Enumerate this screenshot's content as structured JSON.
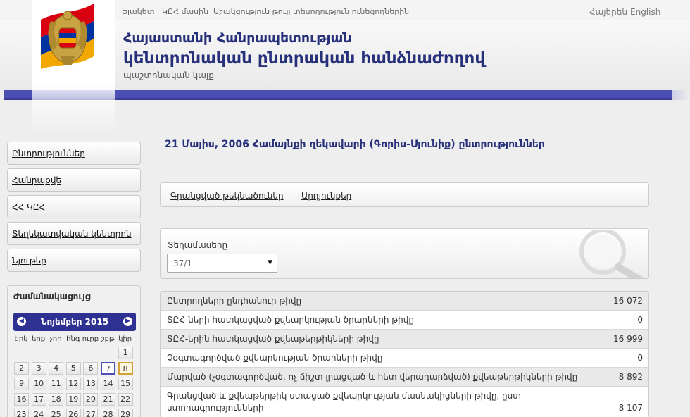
{
  "topnav": {
    "links": [
      "Ելակետ",
      "ԿԸՀ մասին",
      "Աշակցություն թույլ տեսողություն ունեցողներին"
    ],
    "lang_hy": "Հայերեն",
    "lang_en": "English"
  },
  "header": {
    "title_line1": "Հայաստանի Հանրապետության",
    "title_line2": "կենտրոնական ընտրական հանձնաժողով",
    "subtitle": "պաշտոնական կայք"
  },
  "colors": {
    "accent": "#4b4eb2",
    "title": "#27317a",
    "flag_red": "#d90012",
    "flag_blue": "#0033a0",
    "flag_orange": "#f2a800"
  },
  "sidebar": {
    "items": [
      {
        "label": "Ընտրություններ"
      },
      {
        "label": "Հանրաքվե"
      },
      {
        "label": "ՀՀ ԿԸՀ"
      },
      {
        "label": "Տեղեկատվական կենտրոն"
      },
      {
        "label": "Նյութեր"
      }
    ]
  },
  "calendar": {
    "title": "Ժամանակացույց",
    "month": "Նոյեմբեր 2015",
    "prev_icon": "chevron-left-icon",
    "next_icon": "chevron-right-icon",
    "weekdays": [
      "երկ",
      "երք",
      "չոր",
      "հնգ",
      "ուրբ",
      "շբթ",
      "կիր"
    ],
    "weeks": [
      [
        "",
        "",
        "",
        "",
        "",
        "",
        "1"
      ],
      [
        "2",
        "3",
        "4",
        "5",
        "6",
        "7",
        "8"
      ],
      [
        "9",
        "10",
        "11",
        "12",
        "13",
        "14",
        "15"
      ],
      [
        "16",
        "17",
        "18",
        "19",
        "20",
        "21",
        "22"
      ],
      [
        "23",
        "24",
        "25",
        "26",
        "27",
        "28",
        "29"
      ]
    ],
    "today": "7",
    "selected": "8"
  },
  "main": {
    "title": "21 Մայիս, 2006 Համայնքի ղեկավարի (Գորիս-Սյունիք) ընտրություններ",
    "tabs": [
      "Գրանցված թեկնածուներ",
      "Արդյունքեր"
    ],
    "filter": {
      "label": "Տեղամասերը",
      "selected": "37/1"
    },
    "stats": [
      {
        "label": "Ընտրողների ընդհանուր թիվը",
        "value": "16 072"
      },
      {
        "label": "ՏԸՀ-ների հատկացված քվեարկության ծրարների թիվը",
        "value": "0"
      },
      {
        "label": "ՏԸՀ-երին հատկացված քվեաթերթիկների թիվը",
        "value": "16 999"
      },
      {
        "label": "Չօգտագործված քվեարկության ծրարների թիվը",
        "value": "0"
      },
      {
        "label": "Մարված (չօգտագործված, ոչ ճիշտ լրացված և հետ վերադարձված) քվեաթերթիկների թիվը",
        "value": "8 892"
      },
      {
        "label": "Գրանցված և քվեաթերթիկ ստացած քվեարկության մասնակիցների թիվը, ըստ ստորագրությունների",
        "value": "8 107"
      }
    ]
  }
}
